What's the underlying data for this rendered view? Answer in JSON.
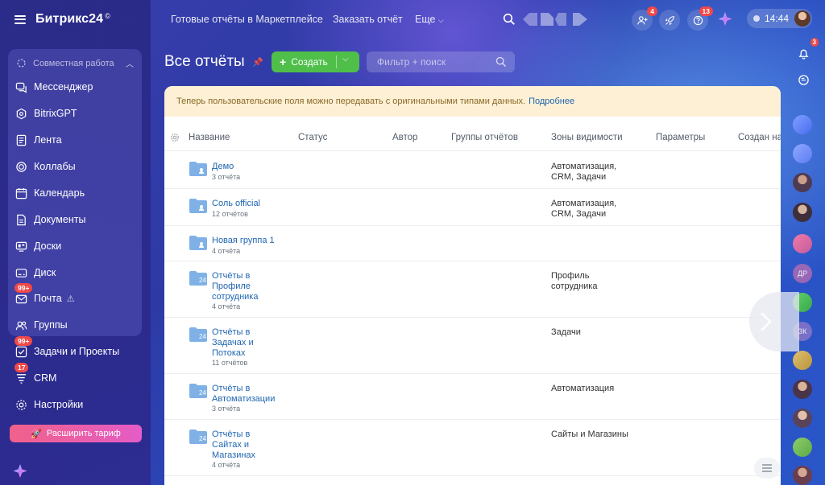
{
  "app": {
    "logo": "Битрикс24",
    "logo_mark": "©"
  },
  "sidebar": {
    "group_label": "Совместная работа",
    "items": [
      {
        "label": "Мессенджер",
        "icon": "chat-icon"
      },
      {
        "label": "BitrixGPT",
        "icon": "gpt-icon"
      },
      {
        "label": "Лента",
        "icon": "feed-icon"
      },
      {
        "label": "Коллабы",
        "icon": "collab-icon"
      },
      {
        "label": "Календарь",
        "icon": "calendar-icon"
      },
      {
        "label": "Документы",
        "icon": "document-icon"
      },
      {
        "label": "Доски",
        "icon": "board-icon"
      },
      {
        "label": "Диск",
        "icon": "disk-icon"
      },
      {
        "label": "Почта",
        "icon": "mail-icon",
        "badge": "99+",
        "warning": "⚠"
      },
      {
        "label": "Группы",
        "icon": "groups-icon"
      },
      {
        "label": "Задачи и Проекты",
        "icon": "tasks-icon",
        "badge": "99+"
      },
      {
        "label": "CRM",
        "icon": "crm-icon",
        "badge": "17"
      },
      {
        "label": "Настройки",
        "icon": "settings-icon"
      }
    ],
    "upgrade_label": "Расширить тариф"
  },
  "topbar": {
    "links": [
      "Готовые отчёты в Маркетплейсе",
      "Заказать отчёт",
      "Еще"
    ],
    "invite_badge": "4",
    "help_badge": "13",
    "time": "14:44"
  },
  "page": {
    "title": "Все отчёты",
    "create_label": "Создать",
    "filter_placeholder": "Фильтр + поиск"
  },
  "notice": {
    "text": "Теперь пользовательские поля можно передавать с оригинальными типами данных.",
    "link": "Подробнее"
  },
  "table": {
    "columns": [
      "Название",
      "Статус",
      "Автор",
      "Группы отчётов",
      "Зоны видимости",
      "Параметры",
      "Создан на"
    ],
    "rows": [
      {
        "name_lines": [
          "Демо"
        ],
        "sub": "3 отчёта",
        "zone_lines": [
          "Автоматизация,",
          "CRM, Задачи"
        ],
        "folder": "group"
      },
      {
        "name_lines": [
          "Соль official"
        ],
        "sub": "12 отчётов",
        "zone_lines": [
          "Автоматизация,",
          "CRM, Задачи"
        ],
        "folder": "group"
      },
      {
        "name_lines": [
          "Новая группа 1"
        ],
        "sub": "4 отчёта",
        "zone_lines": [],
        "folder": "group"
      },
      {
        "name_lines": [
          "Отчёты в",
          "Профиле",
          "сотрудника"
        ],
        "sub": "4 отчёта",
        "zone_lines": [
          "Профиль",
          "сотрудника"
        ],
        "folder": "system"
      },
      {
        "name_lines": [
          "Отчёты в",
          "Задачах и",
          "Потоках"
        ],
        "sub": "11 отчётов",
        "zone_lines": [
          "Задачи"
        ],
        "folder": "system"
      },
      {
        "name_lines": [
          "Отчёты в",
          "Автоматизации"
        ],
        "sub": "3 отчёта",
        "zone_lines": [
          "Автоматизация"
        ],
        "folder": "system"
      },
      {
        "name_lines": [
          "Отчёты в",
          "Сайтах и",
          "Магазинах"
        ],
        "sub": "4 отчёта",
        "zone_lines": [
          "Сайты и Магазины"
        ],
        "folder": "system"
      }
    ]
  },
  "rail": {
    "notif_badge": "3",
    "initials": [
      "ДР",
      "ЗК"
    ]
  },
  "colors": {
    "accent_green": "#4fbf4a",
    "link_blue": "#2066b0",
    "badge_red": "#f04848",
    "notice_bg": "#fdf0d5"
  }
}
